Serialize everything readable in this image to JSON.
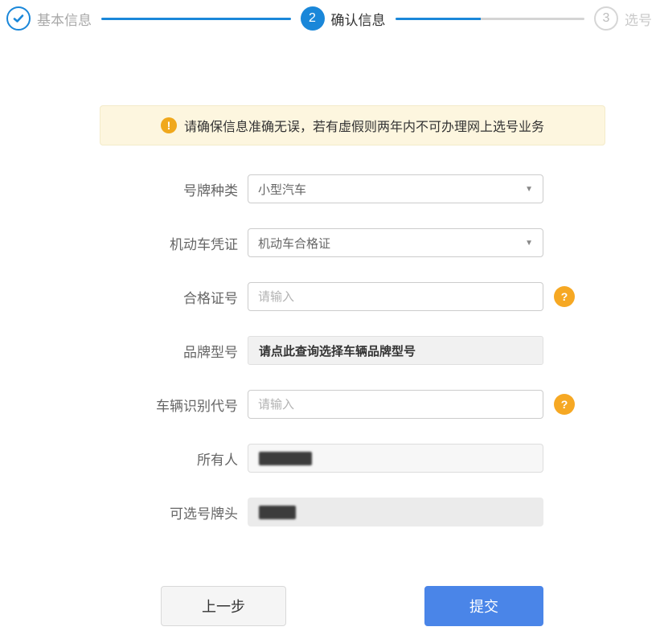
{
  "stepper": {
    "steps": [
      {
        "label": "基本信息",
        "state": "done"
      },
      {
        "number": "2",
        "label": "确认信息",
        "state": "active"
      },
      {
        "number": "3",
        "label": "选号",
        "state": "pending"
      }
    ]
  },
  "notice": {
    "icon_char": "!",
    "text": "请确保信息准确无误，若有虚假则两年内不可办理网上选号业务"
  },
  "form": {
    "select_arrow_char": "▼",
    "help_icon_char": "?",
    "rows": [
      {
        "label": "号牌种类",
        "type": "select",
        "value": "小型汽车"
      },
      {
        "label": "机动车凭证",
        "type": "select",
        "value": "机动车合格证"
      },
      {
        "label": "合格证号",
        "type": "input",
        "placeholder": "请输入",
        "value": "",
        "has_help": true
      },
      {
        "label": "品牌型号",
        "type": "picker",
        "value": "请点此查询选择车辆品牌型号"
      },
      {
        "label": "车辆识别代号",
        "type": "input",
        "placeholder": "请输入",
        "value": "",
        "has_help": true
      },
      {
        "label": "所有人",
        "type": "readonly",
        "value": "",
        "redacted": true
      },
      {
        "label": "可选号牌头",
        "type": "readonly",
        "value": "",
        "redacted": true
      }
    ]
  },
  "actions": {
    "prev_label": "上一步",
    "submit_label": "提交"
  },
  "colors": {
    "stepper_blue": "#1a87d9",
    "submit_blue": "#4a85e8",
    "help_amber": "#f6a823",
    "notice_bg": "#fdf6df",
    "notice_icon": "#f0a81c"
  }
}
